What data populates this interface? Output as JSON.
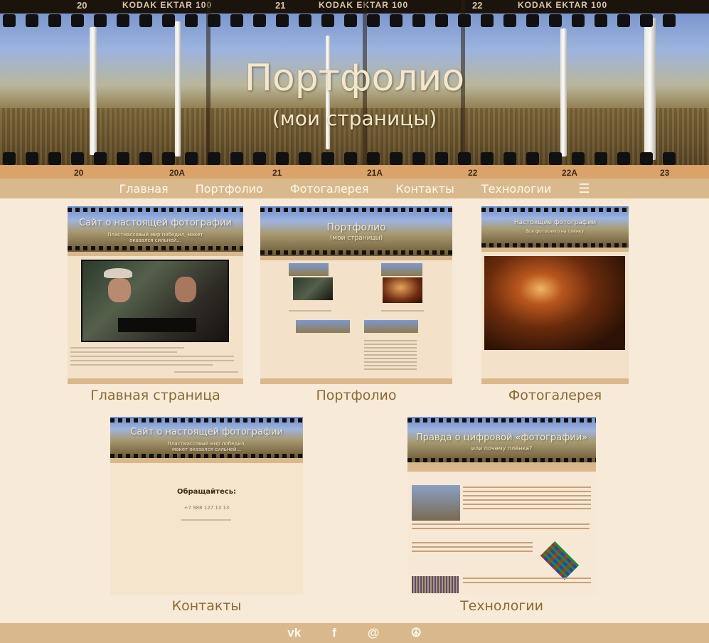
{
  "header": {
    "title": "Портфолио",
    "subtitle": "(мои страницы)",
    "film_brand": "KODAK  EKTAR 100",
    "film_frames_top": [
      "20",
      "21",
      "22"
    ],
    "film_frames_bottom": [
      "20",
      "20A",
      "21",
      "21A",
      "22",
      "22A",
      "23"
    ]
  },
  "nav": {
    "items": [
      "Главная",
      "Портфолио",
      "Фотогалерея",
      "Контакты",
      "Технологии"
    ],
    "menu_icon": "hamburger-icon"
  },
  "cards": [
    {
      "caption": "Главная страница",
      "thumb_title": "Сайт о настоящей фотографии",
      "thumb_sub": "Пластмассовый мир победил, макет оказался сильней..."
    },
    {
      "caption": "Портфолио",
      "thumb_title": "Портфолио",
      "thumb_sub": "(мои страницы)"
    },
    {
      "caption": "Фотогалерея",
      "thumb_title": "Настоящие фотографии",
      "thumb_sub": "Все фотоснято на плёнку"
    },
    {
      "caption": "Контакты",
      "thumb_title": "Сайт о настоящей фотографии",
      "thumb_sub": "Пластмассовый мир победил, макет оказался сильней...",
      "contact_heading": "Обращайтесь:",
      "contact_phone": "+7 988 127 13 13"
    },
    {
      "caption": "Технологии",
      "thumb_title": "Правда о цифровой «фотографии»",
      "thumb_sub": "или почему плёнка?"
    }
  ],
  "footer": {
    "icons": [
      "vk-icon",
      "facebook-icon",
      "mail-icon",
      "peace-icon"
    ],
    "glyphs": [
      "vk",
      "f",
      "@",
      "☮"
    ]
  },
  "colors": {
    "background": "#f8ead9",
    "nav": "#d9b98c",
    "caption": "#8c6a2e",
    "title": "#f7e7c9"
  }
}
